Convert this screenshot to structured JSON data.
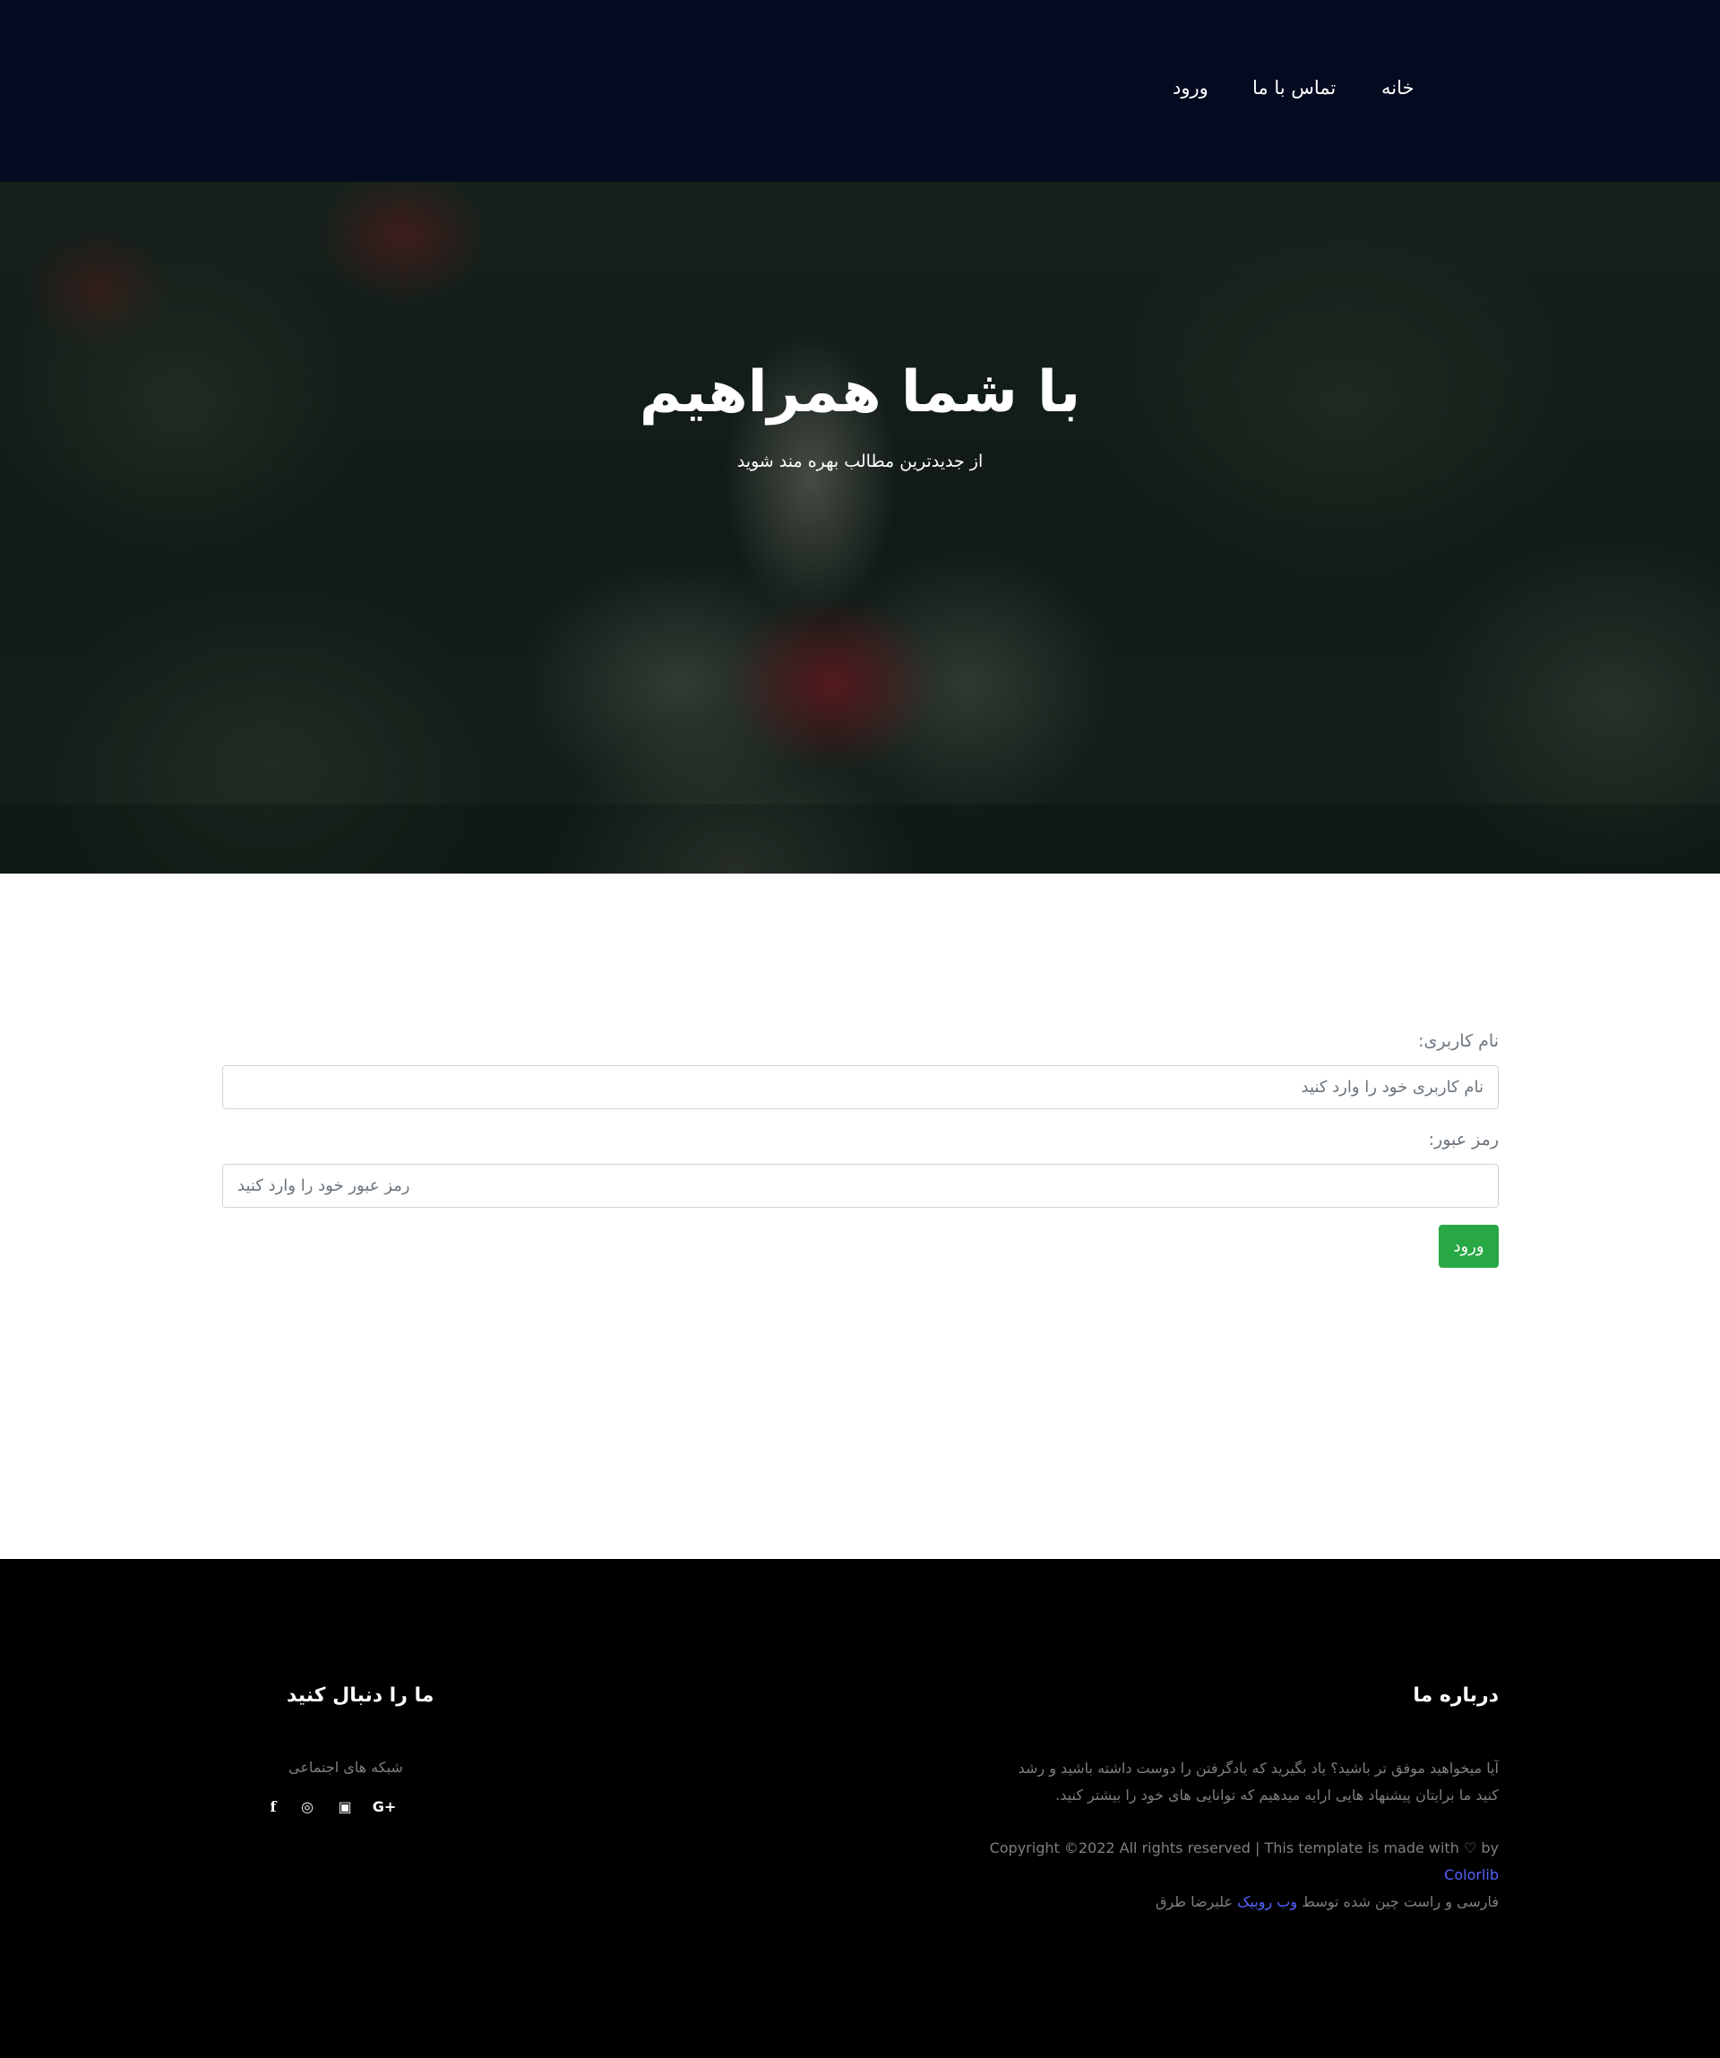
{
  "nav": {
    "home": "خانه",
    "contact": "تماس با ما",
    "login": "ورود"
  },
  "hero": {
    "title": "با شما همراهیم",
    "subtitle": "از جدیدترین مطالب بهره مند شوید"
  },
  "form": {
    "username_label": "نام کاربری:",
    "username_placeholder": "نام کاربری خود را وارد کنید",
    "password_label": "رمز عبور:",
    "password_placeholder": "رمز عبور خود را وارد کنید",
    "submit_label": "ورود"
  },
  "footer": {
    "about_heading": "درباره ما",
    "about_text": "آیا میخواهید موفق تر باشید؟ یاد بگیرید که یادگرفتن را دوست داشته باشید و رشد کنید ما برایتان پیشنهاد هایی ارایه میدهیم که توانایی های خود را بیشتر کنید.",
    "copyright_text": "Copyright ©2022 All rights reserved | This template is made with",
    "heart_icon": "heart-icon",
    "by_text": "by",
    "colorlib_link": "Colorlib",
    "translation_prefix": "فارسی و راست چین شده توسط",
    "webrubik_link": "وب روبیک",
    "translator_name": "علیرضا طرق",
    "follow_heading": "ما را دنبال کنید",
    "social_text": "شبکه های اجتماعی",
    "social": [
      {
        "icon": "facebook-icon",
        "glyph": "f"
      },
      {
        "icon": "instagram-icon",
        "glyph": "◎"
      },
      {
        "icon": "youtube-icon",
        "glyph": "▣"
      },
      {
        "icon": "google-plus-icon",
        "glyph": "G+"
      }
    ]
  },
  "colors": {
    "navbar_bg": "#040a1f",
    "button_green": "#28a745",
    "link_blue": "#5463ff",
    "footer_bg": "#000000"
  }
}
